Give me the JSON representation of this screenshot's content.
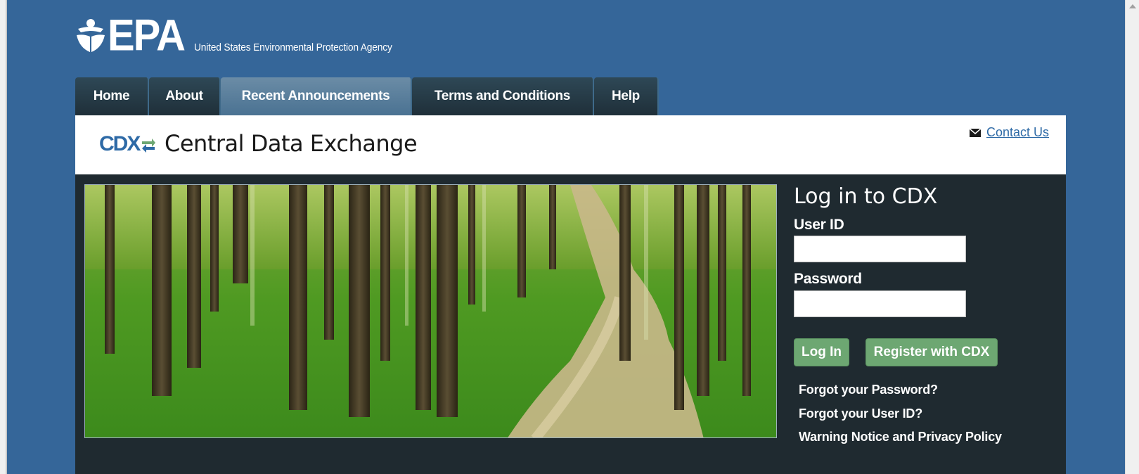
{
  "header": {
    "logo_text": "EPA",
    "agency_name": "United States Environmental Protection Agency"
  },
  "nav": {
    "tabs": [
      {
        "label": "Home",
        "active": false
      },
      {
        "label": "About",
        "active": false
      },
      {
        "label": "Recent Announcements",
        "active": true
      },
      {
        "label": "Terms and Conditions",
        "active": false
      },
      {
        "label": "Help",
        "active": false
      }
    ]
  },
  "banner": {
    "logo_text": "CDX",
    "title": "Central Data Exchange",
    "contact_label": "Contact Us",
    "contact_icon": "envelope-icon"
  },
  "login": {
    "title": "Log in to CDX",
    "user_id_label": "User ID",
    "user_id_value": "",
    "password_label": "Password",
    "password_value": "",
    "login_button": "Log In",
    "register_button": "Register with CDX",
    "links": [
      "Forgot your Password?",
      "Forgot your User ID?",
      "Warning Notice and Privacy Policy"
    ]
  },
  "hero_image": {
    "description_icon": "forest-path-image"
  },
  "colors": {
    "page_bg": "#356699",
    "nav_bg": "#1f2f39",
    "nav_active": "#5a7f9d",
    "content_bg": "#1f2a30",
    "button_green": "#6da772",
    "link_blue": "#2e6aa6"
  }
}
